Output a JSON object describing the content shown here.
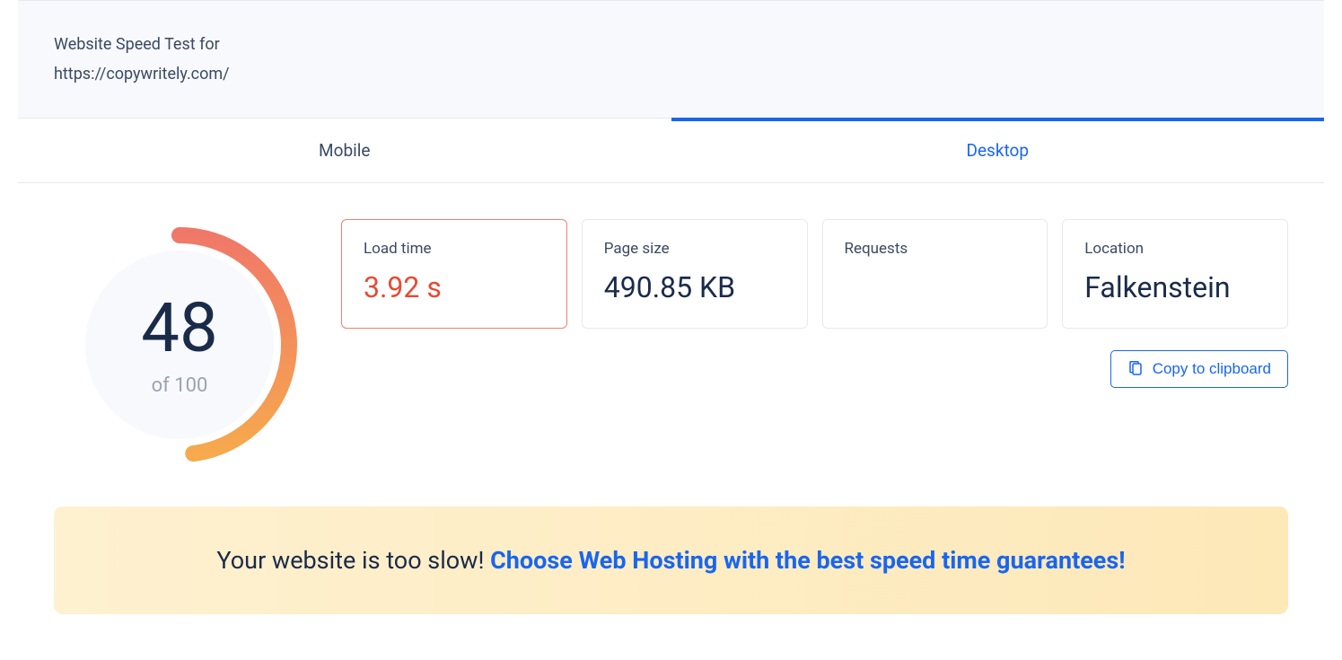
{
  "header": {
    "title": "Website Speed Test for",
    "url": "https://copywritely.com/"
  },
  "tabs": [
    {
      "label": "Mobile",
      "active": false
    },
    {
      "label": "Desktop",
      "active": true
    }
  ],
  "score": {
    "value": "48",
    "of": "of 100",
    "percent": 48
  },
  "metrics": [
    {
      "label": "Load time",
      "value": "3.92 s",
      "warn": true
    },
    {
      "label": "Page size",
      "value": "490.85 KB",
      "warn": false
    },
    {
      "label": "Requests",
      "value": "",
      "warn": false
    },
    {
      "label": "Location",
      "value": "Falkenstein",
      "warn": false
    }
  ],
  "copy_label": "Copy to clipboard",
  "banner": {
    "text": "Your website is too slow! ",
    "link": "Choose Web Hosting with the best speed time guarantees!"
  }
}
